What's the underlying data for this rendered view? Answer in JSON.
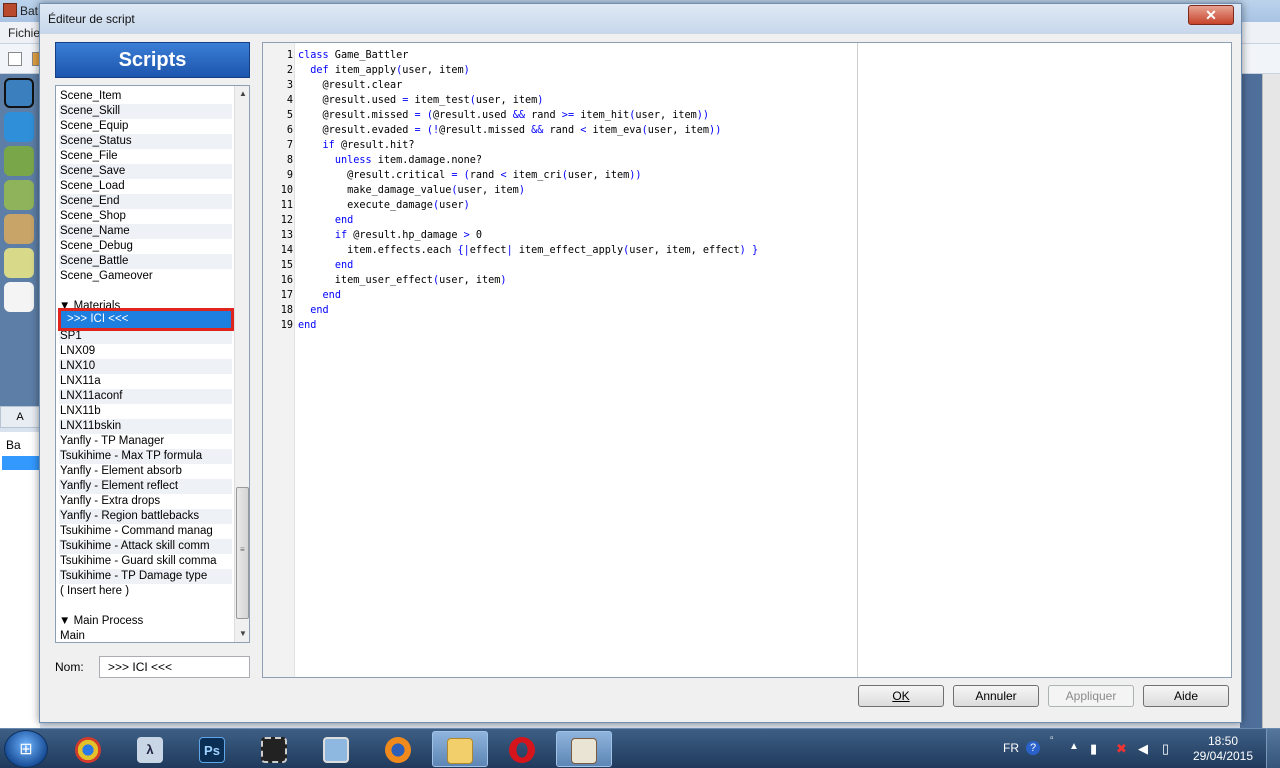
{
  "background_app": {
    "title": "Bat",
    "menu_first": "Fichie",
    "tab_label": "A",
    "tree_item": "Ba"
  },
  "dialog": {
    "title": "Éditeur de script",
    "close_glyph": "✕"
  },
  "scripts_panel": {
    "header": "Scripts",
    "items_top": [
      "Scene_Item",
      "Scene_Skill",
      "Scene_Equip",
      "Scene_Status",
      "Scene_File",
      "Scene_Save",
      "Scene_Load",
      "Scene_End",
      "Scene_Shop",
      "Scene_Name",
      "Scene_Debug",
      "Scene_Battle",
      "Scene_Gameover"
    ],
    "section_materials": "▼ Materials",
    "selected_item": ">>> ICI <<<",
    "items_materials": [
      "SP1",
      "LNX09",
      "LNX10",
      "LNX11a",
      "LNX11aconf",
      "LNX11b",
      "LNX11bskin",
      "Yanfly - TP Manager",
      "Tsukihime - Max TP formula",
      "Yanfly - Element absorb",
      "Yanfly - Element reflect",
      "Yanfly - Extra drops",
      "Yanfly - Region battlebacks",
      "Tsukihime - Command manag",
      "Tsukihime - Attack skill comm",
      "Tsukihime - Guard skill comma",
      "Tsukihime - TP Damage type",
      "( Insert here )"
    ],
    "section_main": "▼ Main Process",
    "items_main": [
      "Main"
    ],
    "scroll_up": "▲",
    "scroll_down": "▼"
  },
  "name_field": {
    "label": "Nom:",
    "value": ">>> ICI <<<"
  },
  "editor": {
    "lines": [
      {
        "no": "1",
        "code": "class Game_Battler"
      },
      {
        "no": "2",
        "code": "  def item_apply(user, item)"
      },
      {
        "no": "3",
        "code": "    @result.clear"
      },
      {
        "no": "4",
        "code": "    @result.used = item_test(user, item)"
      },
      {
        "no": "5",
        "code": "    @result.missed = (@result.used && rand >= item_hit(user, item))"
      },
      {
        "no": "6",
        "code": "    @result.evaded = (!@result.missed && rand < item_eva(user, item))"
      },
      {
        "no": "7",
        "code": "    if @result.hit?"
      },
      {
        "no": "8",
        "code": "      unless item.damage.none?"
      },
      {
        "no": "9",
        "code": "        @result.critical = (rand < item_cri(user, item))"
      },
      {
        "no": "10",
        "code": "        make_damage_value(user, item)"
      },
      {
        "no": "11",
        "code": "        execute_damage(user)"
      },
      {
        "no": "12",
        "code": "      end"
      },
      {
        "no": "13",
        "code": "      if @result.hp_damage > 0"
      },
      {
        "no": "14",
        "code": "        item.effects.each {|effect| item_effect_apply(user, item, effect) }"
      },
      {
        "no": "15",
        "code": "      end"
      },
      {
        "no": "16",
        "code": "      item_user_effect(user, item)"
      },
      {
        "no": "17",
        "code": "    end"
      },
      {
        "no": "18",
        "code": "  end"
      },
      {
        "no": "19",
        "code": "end"
      }
    ]
  },
  "buttons": {
    "ok": "OK",
    "cancel": "Annuler",
    "apply": "Appliquer",
    "help": "Aide"
  },
  "taskbar": {
    "language": "FR",
    "time": "18:50",
    "date": "29/04/2015",
    "apps": [
      "chrome",
      "ruby",
      "photoshop",
      "film",
      "computer",
      "firefox",
      "explorer",
      "opera",
      "rpgmaker"
    ]
  },
  "colors": {
    "accent_blue": "#1e7fe0",
    "highlight_red": "#e0241e",
    "keyword_blue": "#0000ff"
  }
}
